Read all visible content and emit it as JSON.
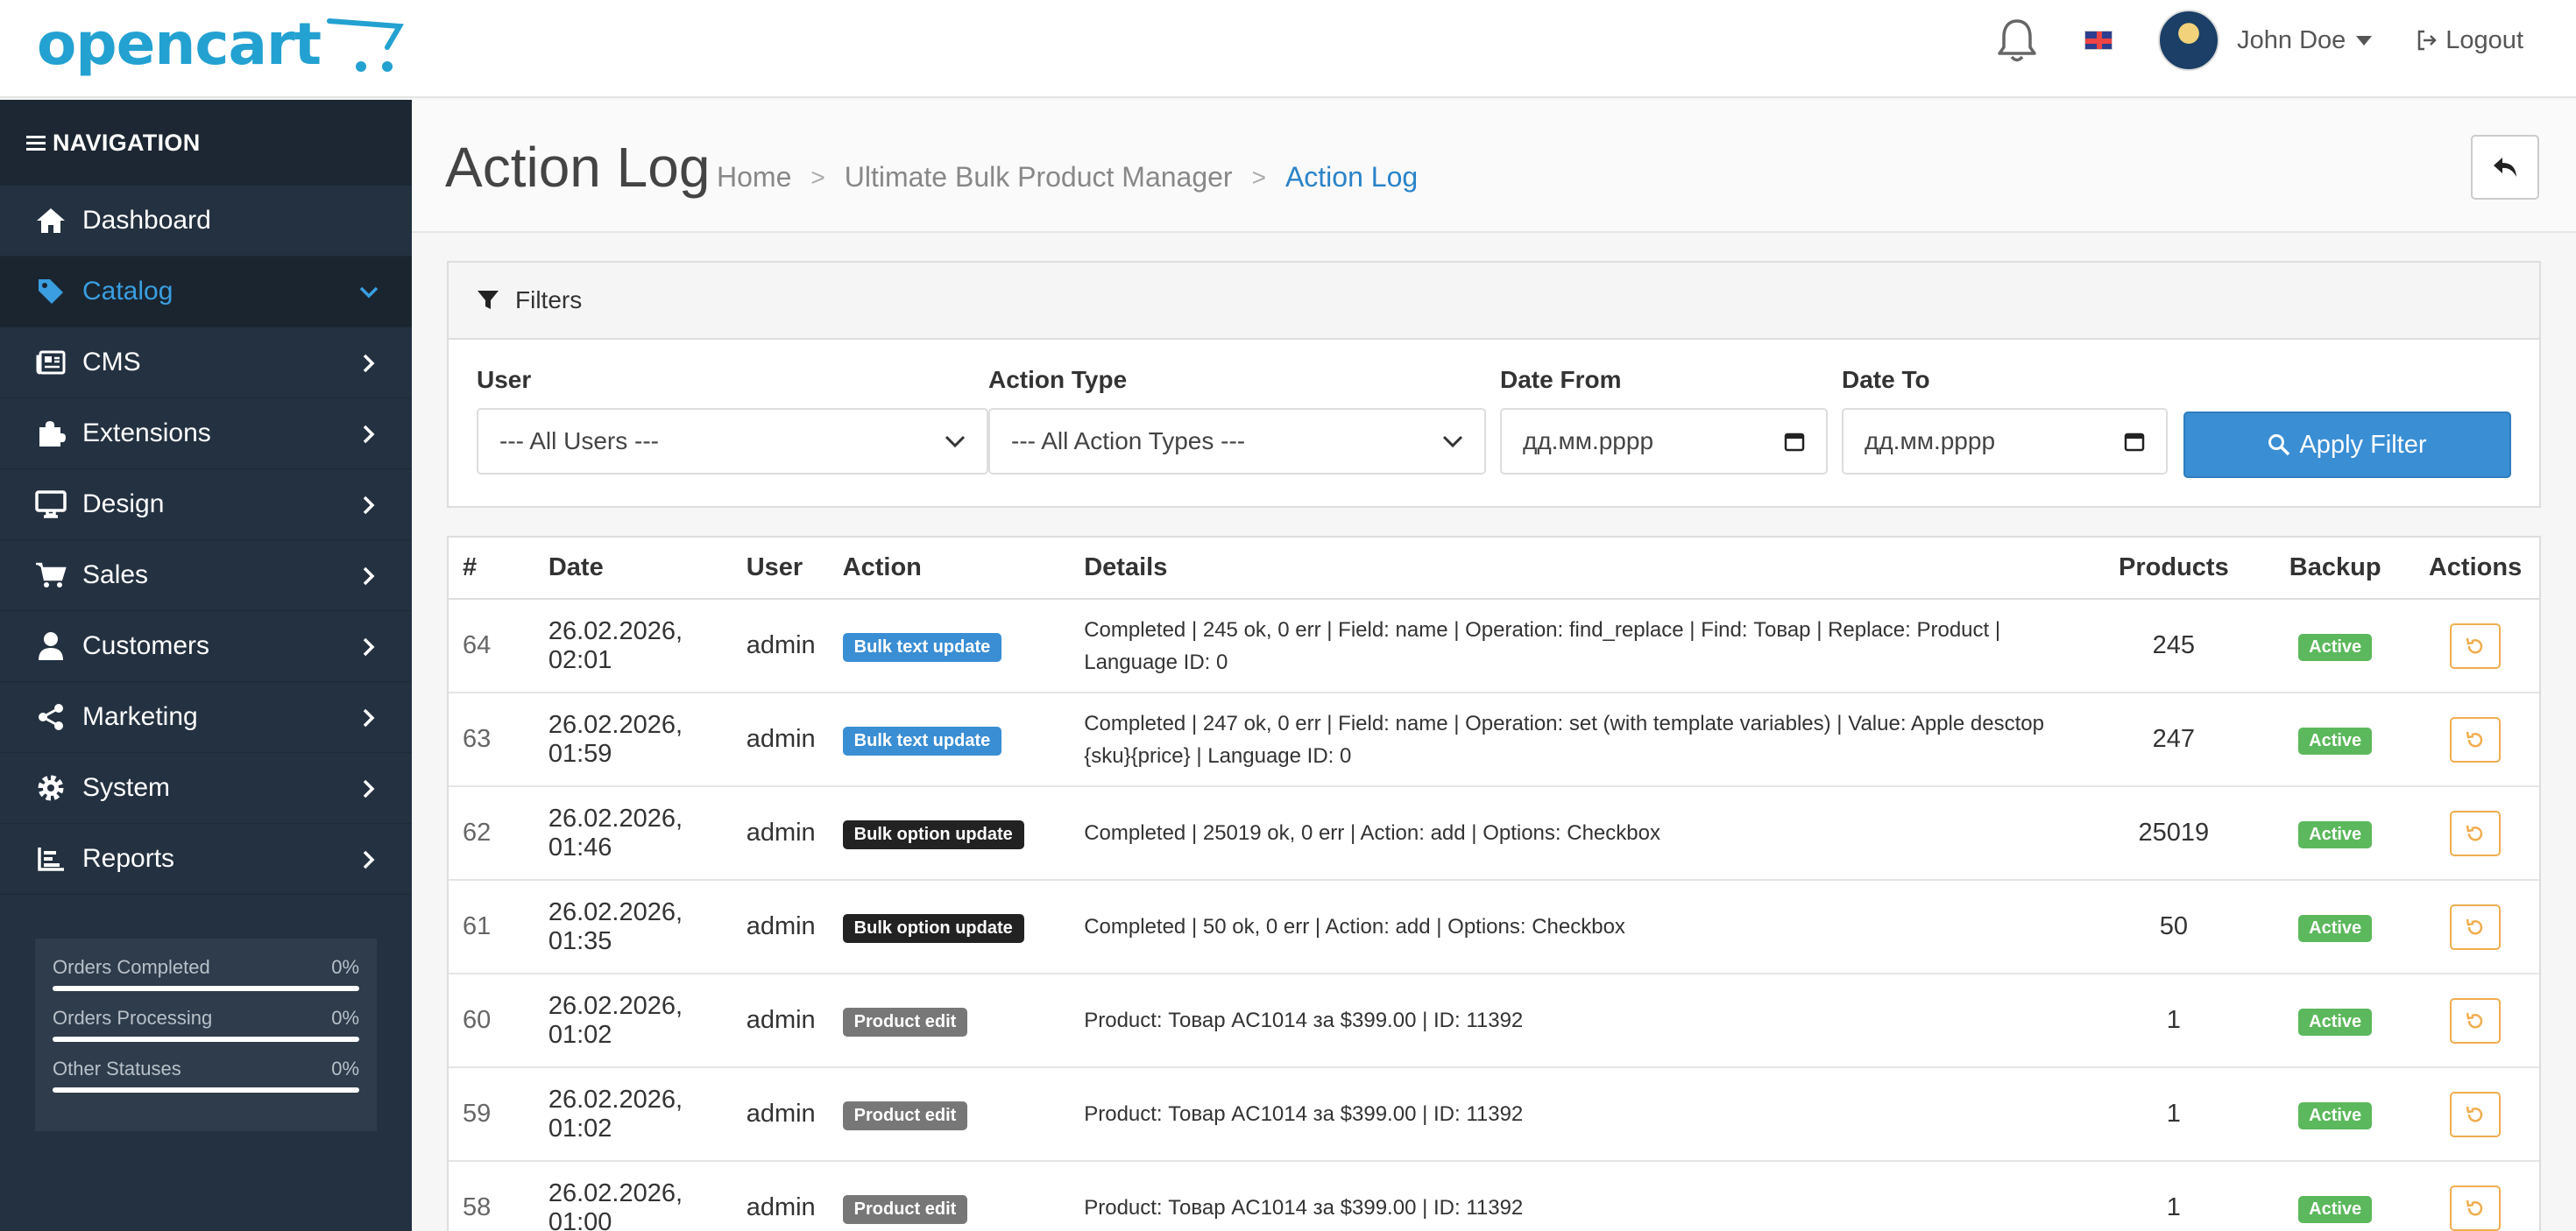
{
  "header": {
    "logo_text": "opencart",
    "username": "John Doe",
    "logout_label": "Logout"
  },
  "sidebar": {
    "heading": "NAVIGATION",
    "items": [
      {
        "label": "Dashboard",
        "icon": "home-icon"
      },
      {
        "label": "Catalog",
        "icon": "tag-icon"
      },
      {
        "label": "CMS",
        "icon": "newspaper-icon"
      },
      {
        "label": "Extensions",
        "icon": "puzzle-icon"
      },
      {
        "label": "Design",
        "icon": "desktop-icon"
      },
      {
        "label": "Sales",
        "icon": "cart-icon"
      },
      {
        "label": "Customers",
        "icon": "user-icon"
      },
      {
        "label": "Marketing",
        "icon": "share-icon"
      },
      {
        "label": "System",
        "icon": "gear-icon"
      },
      {
        "label": "Reports",
        "icon": "bar-chart-icon"
      }
    ],
    "stats": [
      {
        "label": "Orders Completed",
        "value": "0%"
      },
      {
        "label": "Orders Processing",
        "value": "0%"
      },
      {
        "label": "Other Statuses",
        "value": "0%"
      }
    ]
  },
  "page": {
    "title": "Action Log",
    "breadcrumb": [
      "Home",
      "Ultimate Bulk Product Manager",
      "Action Log"
    ]
  },
  "filters": {
    "heading": "Filters",
    "user_label": "User",
    "user_value": "--- All Users ---",
    "action_label": "Action Type",
    "action_value": "--- All Action Types ---",
    "date_from_label": "Date From",
    "date_from_value": "дд.мм.рррр",
    "date_to_label": "Date To",
    "date_to_value": "дд.мм.рррр",
    "apply_label": "Apply Filter"
  },
  "table": {
    "columns": [
      "#",
      "Date",
      "User",
      "Action",
      "Details",
      "Products",
      "Backup",
      "Actions"
    ],
    "rows": [
      {
        "id": "64",
        "date1": "26.02.2026,",
        "date2": "02:01",
        "user": "admin",
        "action": "Bulk text update",
        "badge": "blue",
        "details": "Completed | 245 ok, 0 err | Field: name | Operation: find_replace | Find: Товар | Replace: Product | Language ID: 0",
        "products": "245",
        "backup": "Active"
      },
      {
        "id": "63",
        "date1": "26.02.2026,",
        "date2": "01:59",
        "user": "admin",
        "action": "Bulk text update",
        "badge": "blue",
        "details": "Completed | 247 ok, 0 err | Field: name | Operation: set (with template variables) | Value: Apple desctop {sku}{price} | Language ID: 0",
        "products": "247",
        "backup": "Active"
      },
      {
        "id": "62",
        "date1": "26.02.2026,",
        "date2": "01:46",
        "user": "admin",
        "action": "Bulk option update",
        "badge": "dark",
        "details": "Completed | 25019 ok, 0 err | Action: add | Options: Checkbox",
        "products": "25019",
        "backup": "Active"
      },
      {
        "id": "61",
        "date1": "26.02.2026,",
        "date2": "01:35",
        "user": "admin",
        "action": "Bulk option update",
        "badge": "dark",
        "details": "Completed | 50 ok, 0 err | Action: add | Options: Checkbox",
        "products": "50",
        "backup": "Active"
      },
      {
        "id": "60",
        "date1": "26.02.2026,",
        "date2": "01:02",
        "user": "admin",
        "action": "Product edit",
        "badge": "gray",
        "details": "Product: Товар AC1014 за $399.00 | ID: 11392",
        "products": "1",
        "backup": "Active"
      },
      {
        "id": "59",
        "date1": "26.02.2026,",
        "date2": "01:02",
        "user": "admin",
        "action": "Product edit",
        "badge": "gray",
        "details": "Product: Товар AC1014 за $399.00 | ID: 11392",
        "products": "1",
        "backup": "Active"
      },
      {
        "id": "58",
        "date1": "26.02.2026,",
        "date2": "01:00",
        "user": "admin",
        "action": "Product edit",
        "badge": "gray",
        "details": "Product: Товар AC1014 за $399.00 | ID: 11392",
        "products": "1",
        "backup": "Active"
      }
    ]
  },
  "colors": {
    "accent": "#3a8ed4",
    "sidebar_bg": "#233140",
    "success": "#5cb85c",
    "warning": "#f0ad4e"
  }
}
